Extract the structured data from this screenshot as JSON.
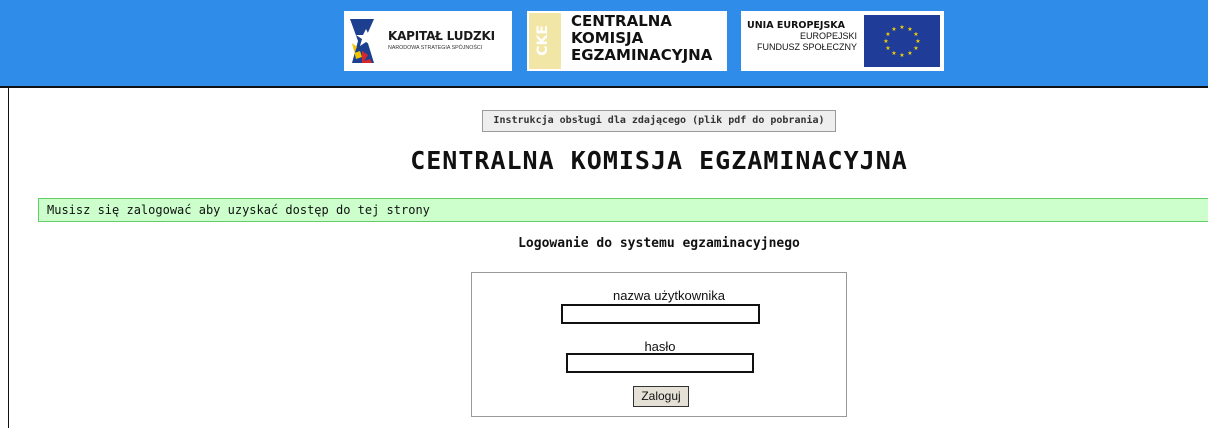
{
  "header": {
    "background_color": "#2f8ce8",
    "logos": {
      "kapital_ludzki": {
        "title": "KAPITAŁ LUDZKI",
        "subtitle": "NARODOWA STRATEGIA SPÓJNOŚCI"
      },
      "cke": {
        "badge": "CKE",
        "line1": "CENTRALNA",
        "line2": "KOMISJA",
        "line3": "EGZAMINACYJNA"
      },
      "ue": {
        "line1": "UNIA EUROPEJSKA",
        "line2": "EUROPEJSKI",
        "line3": "FUNDUSZ SPOŁECZNY"
      }
    }
  },
  "main": {
    "instruction_button": "Instrukcja obsługi dla zdającego (plik pdf do pobrania)",
    "title": "CENTRALNA KOMISJA EGZAMINACYJNA",
    "notice": "Musisz się zalogować aby uzyskać dostęp do tej strony",
    "notice_bg": "#ccffcc",
    "login_heading": "Logowanie do systemu egzaminacyjnego"
  },
  "login": {
    "username_label": "nazwa użytkownika",
    "username_value": "",
    "password_label": "hasło",
    "password_value": "",
    "submit_label": "Zaloguj"
  }
}
